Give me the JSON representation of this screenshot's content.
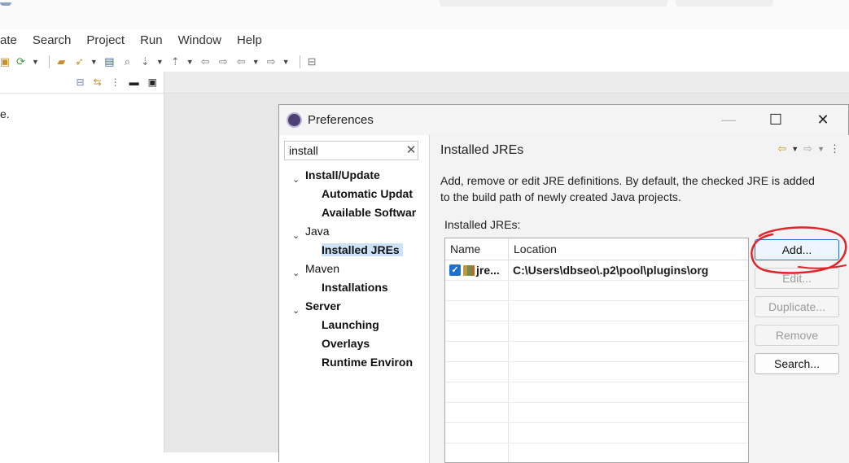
{
  "ide": {
    "menu": [
      "ate",
      "Search",
      "Project",
      "Run",
      "Window",
      "Help"
    ],
    "left_view_text": "e."
  },
  "dialog": {
    "title": "Preferences",
    "filter": {
      "value": "install"
    },
    "tree": [
      {
        "label": "Install/Update",
        "level": 0,
        "expanded": true,
        "bold": true
      },
      {
        "label": "Automatic Updat",
        "level": 1,
        "bold": true
      },
      {
        "label": "Available Softwar",
        "level": 1,
        "bold": true
      },
      {
        "label": "Java",
        "level": 0,
        "expanded": true,
        "bold": false
      },
      {
        "label": "Installed JREs",
        "level": 1,
        "bold": true,
        "selected": true
      },
      {
        "label": "Maven",
        "level": 0,
        "expanded": true,
        "bold": false
      },
      {
        "label": "Installations",
        "level": 1,
        "bold": true
      },
      {
        "label": "Server",
        "level": 0,
        "expanded": true,
        "bold": true
      },
      {
        "label": "Launching",
        "level": 1,
        "bold": true
      },
      {
        "label": "Overlays",
        "level": 1,
        "bold": true
      },
      {
        "label": "Runtime Environ",
        "level": 1,
        "bold": true
      }
    ],
    "page": {
      "title": "Installed JREs",
      "description": "Add, remove or edit JRE definitions. By default, the checked JRE is added to the build path of newly created Java projects.",
      "table_label": "Installed JREs:",
      "columns": [
        "Name",
        "Location"
      ],
      "rows": [
        {
          "checked": true,
          "name": "jre...",
          "location": "C:\\Users\\dbseo\\.p2\\pool\\plugins\\org"
        }
      ],
      "buttons": {
        "add": "Add...",
        "edit": "Edit...",
        "duplicate": "Duplicate...",
        "remove": "Remove",
        "search": "Search..."
      }
    }
  },
  "colors": {
    "selection": "#cce2f7",
    "checkbox": "#1d6fd1",
    "annotation": "#e0242b"
  }
}
